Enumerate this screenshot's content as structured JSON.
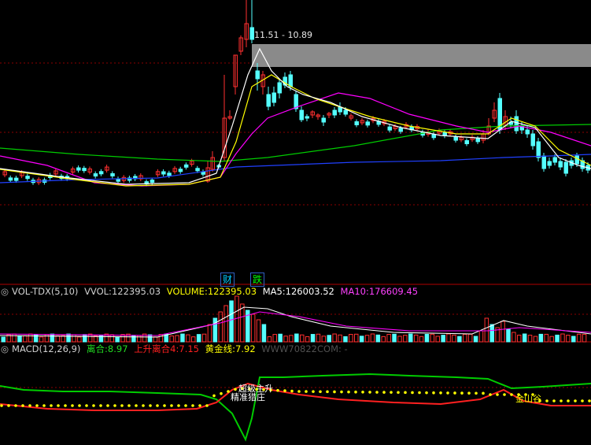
{
  "price_chart": {
    "gap_label": "11.51 - 10.89",
    "badges": [
      {
        "text": "财",
        "color": "#00ccff"
      },
      {
        "text": "跌",
        "color": "#00ff00"
      }
    ]
  },
  "volume": {
    "indicator": "VOL-TDX(5,10)",
    "vvol_label": "VVOL:",
    "vvol_value": "122395.03",
    "volume_label": "VOLUME:",
    "volume_value": "122395.03",
    "ma5_label": "MA5:",
    "ma5_value": "126003.52",
    "ma10_label": "MA10:",
    "ma10_value": "176609.45"
  },
  "macd": {
    "indicator": "MACD(12,26,9)",
    "line1_label": "离合:",
    "line1_value": "8.97",
    "line2_label": "上升离合4:",
    "line2_value": "7.15",
    "line3_label": "黄金线:",
    "line3_value": "7.92",
    "watermark": "WWW70822COM: -",
    "annotations": [
      "超级主升",
      "精准猎庄",
      "金山谷"
    ],
    "colors": {
      "line1": "#22dd22",
      "line2": "#ff2020",
      "line3": "#ffff00"
    }
  },
  "colors": {
    "up": "#ff3030",
    "down": "#54ffff",
    "ma_white": "#ffffff",
    "ma_yellow": "#ffff00",
    "ma_magenta": "#ff00ff",
    "ma_green": "#00cc00",
    "ma_blue": "#2040ff",
    "grid": "#8b0000"
  }
}
